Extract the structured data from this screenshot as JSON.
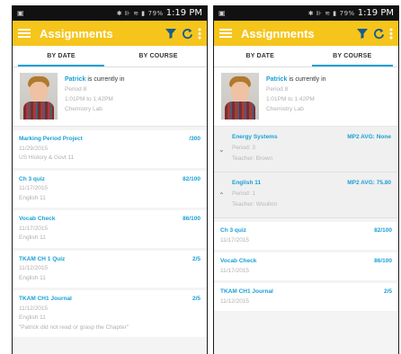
{
  "status": {
    "time": "1:19 PM",
    "battery": "79%"
  },
  "appbar": {
    "title": "Assignments"
  },
  "tabs": {
    "by_date": "BY DATE",
    "by_course": "BY COURSE"
  },
  "student": {
    "name": "Patrick",
    "status_text": "is currently in",
    "period": "Period 8",
    "time_range": "1:01PM to 1:42PM",
    "room": "Chemistry Lab"
  },
  "by_date_items": [
    {
      "title": "Marking Period Project",
      "score": "/300",
      "date": "11/29/2015",
      "note": "US History & Govt 11"
    },
    {
      "title": "Ch 3 quiz",
      "score": "82/100",
      "date": "11/17/2015",
      "note": "English 11"
    },
    {
      "title": "Vocab Check",
      "score": "86/100",
      "date": "11/17/2015",
      "note": "English 11"
    },
    {
      "title": "TKAM CH 1 Quiz",
      "score": "2/5",
      "date": "11/12/2015",
      "note": "English 11"
    },
    {
      "title": "TKAM CH1 Journal",
      "score": "2/5",
      "date": "11/12/2015",
      "note": "English 11",
      "comment": "\"Patrick did not read or grasp the Chapter\""
    }
  ],
  "courses": [
    {
      "name": "Energy Systems",
      "avg": "MP2 AVG: None",
      "period": "Period: 3",
      "teacher": "Teacher: Brown",
      "expanded": false
    },
    {
      "name": "English 11",
      "avg": "MP2 AVG: 75.80",
      "period": "Period: 1",
      "teacher": "Teacher: Woollon",
      "expanded": true
    }
  ],
  "course_items": [
    {
      "title": "Ch 3 quiz",
      "score": "82/100",
      "date": "11/17/2015"
    },
    {
      "title": "Vocab Check",
      "score": "86/100",
      "date": "11/17/2015"
    },
    {
      "title": "TKAM CH1 Journal",
      "score": "2/5",
      "date": "11/12/2015"
    }
  ],
  "colors": {
    "accent": "#f5c51c",
    "link": "#1a9fd6"
  }
}
